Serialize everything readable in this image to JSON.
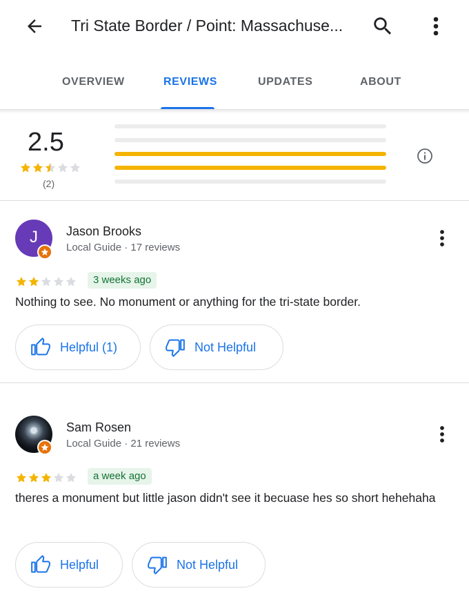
{
  "header": {
    "title": "Tri State Border / Point: Massachuse...",
    "back_icon": "arrow-back-icon",
    "search_icon": "search-icon",
    "more_icon": "more-vert-icon"
  },
  "tabs": [
    {
      "label": "OVERVIEW",
      "active": false
    },
    {
      "label": "REVIEWS",
      "active": true
    },
    {
      "label": "UPDATES",
      "active": false
    },
    {
      "label": "ABOUT",
      "active": false
    }
  ],
  "summary": {
    "average": "2.5",
    "stars": 2.5,
    "count": "(2)",
    "distribution": [
      {
        "stars": 5,
        "fraction": 0
      },
      {
        "stars": 4,
        "fraction": 0
      },
      {
        "stars": 3,
        "fraction": 1
      },
      {
        "stars": 2,
        "fraction": 1
      },
      {
        "stars": 1,
        "fraction": 0
      }
    ]
  },
  "reviews": [
    {
      "avatar_letter": "J",
      "name": "Jason Brooks",
      "meta": "Local Guide · 17 reviews",
      "rating": 2,
      "date": "3 weeks ago",
      "text": "Nothing to see. No monument or anything for the tri-state border.",
      "helpful_label": "Helpful (1)",
      "not_helpful_label": "Not Helpful"
    },
    {
      "name": "Sam Rosen",
      "meta": "Local Guide · 21 reviews",
      "rating": 3,
      "date": "a week ago",
      "text": "theres a monument but little jason didn't see it becuase hes so short hehehaha",
      "helpful_label": "Helpful",
      "not_helpful_label": "Not Helpful"
    }
  ],
  "colors": {
    "accent": "#1a73e8",
    "star": "#f4b400",
    "star_empty": "#dadce0",
    "avatar_j": "#673ab7",
    "guide_badge": "#e8710a",
    "date_chip_bg": "#e6f4ea",
    "date_chip_text": "#137333"
  }
}
